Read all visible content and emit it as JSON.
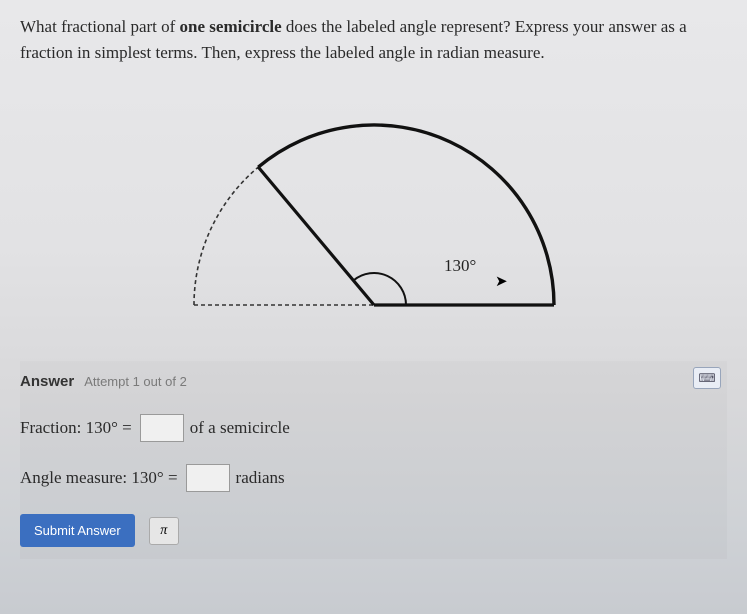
{
  "question": {
    "part1": "What fractional part of ",
    "bold": "one semicircle",
    "part2": " does the labeled angle represent? Express your answer as a fraction in simplest terms. Then, express the labeled angle in radian measure."
  },
  "diagram": {
    "angle_label": "130°"
  },
  "answer": {
    "header_label": "Answer",
    "attempt_text": "Attempt 1 out of 2",
    "fraction_label": "Fraction: 130° =",
    "fraction_suffix": "of a semicircle",
    "angle_label": "Angle measure: 130° =",
    "angle_suffix": "radians",
    "fraction_value": "",
    "angle_value": ""
  },
  "buttons": {
    "submit": "Submit Answer",
    "pi": "π"
  },
  "icons": {
    "keyboard": "⌨"
  }
}
